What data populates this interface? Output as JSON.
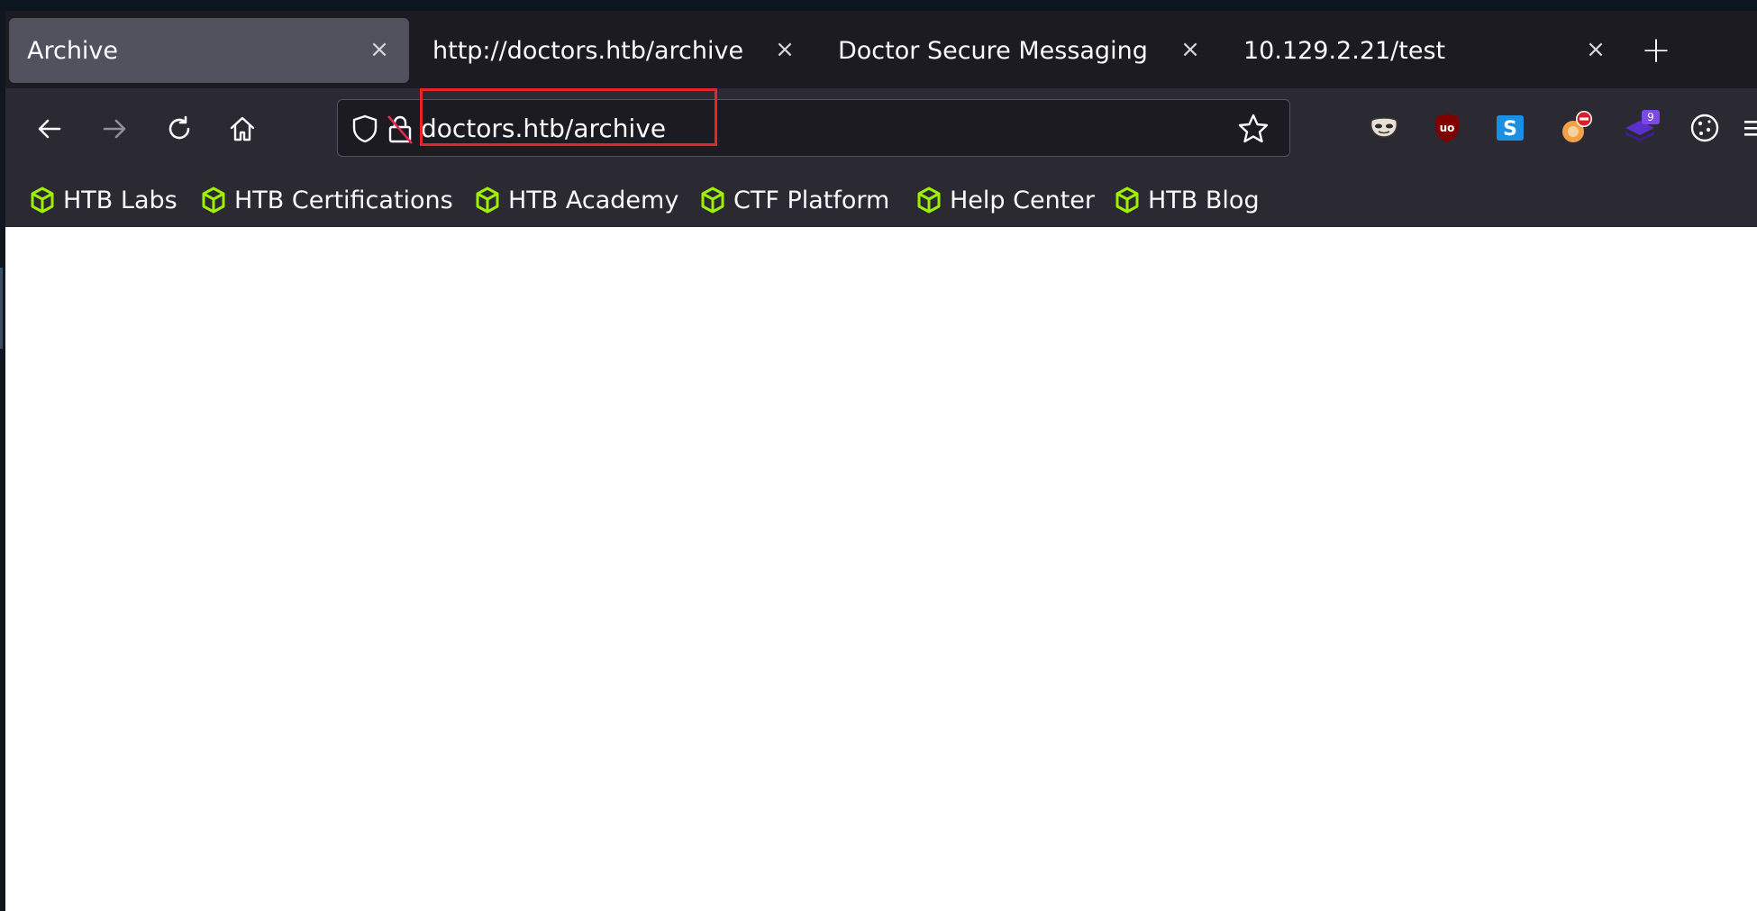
{
  "tabs": [
    {
      "title": "Archive",
      "active": true
    },
    {
      "title": "http://doctors.htb/archive",
      "active": false
    },
    {
      "title": "Doctor Secure Messaging",
      "active": false
    },
    {
      "title": "10.129.2.21/test",
      "active": false
    }
  ],
  "tab_close_glyph": "×",
  "new_tab_glyph": "+",
  "navbar": {
    "url": "doctors.htb/archive"
  },
  "extensions": [
    {
      "icon": "mask-extension-icon"
    },
    {
      "icon": "ublock-origin-icon",
      "label": "uo"
    },
    {
      "icon": "s-extension-icon",
      "label": "S"
    },
    {
      "icon": "blocker-extension-icon"
    },
    {
      "icon": "layers-extension-icon",
      "badge": "9"
    },
    {
      "icon": "cookie-extension-icon"
    }
  ],
  "bookmarks": [
    {
      "label": "HTB Labs"
    },
    {
      "label": "HTB Certifications"
    },
    {
      "label": "HTB Academy"
    },
    {
      "label": "CTF Platform"
    },
    {
      "label": "Help Center"
    },
    {
      "label": "HTB Blog"
    }
  ],
  "colors": {
    "tab_bar": "#1c1b22",
    "toolbar": "#2b2a33",
    "highlight": "#e3262a",
    "bookmark_icon": "#9fef00"
  }
}
